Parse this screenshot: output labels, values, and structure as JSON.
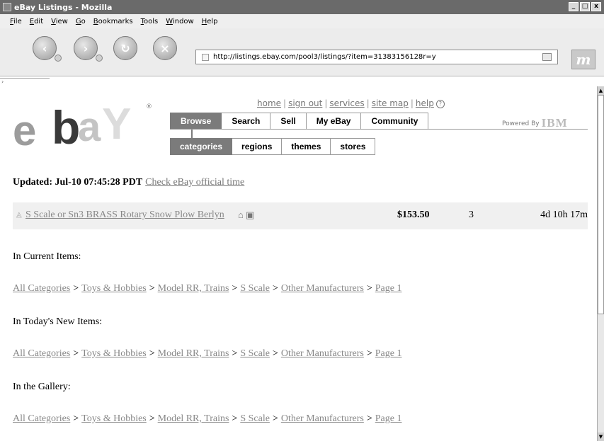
{
  "window": {
    "title": "eBay Listings - Mozilla",
    "controls": [
      "_",
      "□",
      "x"
    ]
  },
  "menu": [
    "File",
    "Edit",
    "View",
    "Go",
    "Bookmarks",
    "Tools",
    "Window",
    "Help"
  ],
  "toolbar": {
    "back_icon": "back-arrow",
    "forward_icon": "forward-arrow",
    "reload_icon": "reload",
    "stop_icon": "stop",
    "url": "http://listings.ebay.com/pool3/listings/?item=31383156128r=y",
    "throbber_label": "m"
  },
  "header": {
    "logo_letters": [
      "e",
      "b",
      "a",
      "Y"
    ],
    "logo_reg": "®",
    "links": [
      "home",
      "sign out",
      "services",
      "site map",
      "help"
    ],
    "help_icon": "?",
    "tabs": [
      "Browse",
      "Search",
      "Sell",
      "My eBay",
      "Community"
    ],
    "powered_by": "Powered By",
    "powered_brand": "IBM",
    "subtabs": [
      "categories",
      "regions",
      "themes",
      "stores"
    ]
  },
  "updated": {
    "label": "Updated: Jul-10 07:45:28 PDT",
    "link": "Check eBay official time"
  },
  "item": {
    "title": "S Scale or Sn3 BRASS Rotary Snow Plow Berlyn",
    "icons": "⌂ ▣",
    "price": "$153.50",
    "bids": "3",
    "time_left": "4d 10h 17m"
  },
  "sections": [
    {
      "label": "In Current Items:",
      "crumbs": [
        "All Categories",
        "Toys & Hobbies",
        "Model RR, Trains",
        "S Scale",
        "Other Manufacturers",
        "Page 1"
      ]
    },
    {
      "label": "In Today's New Items:",
      "crumbs": [
        "All Categories",
        "Toys & Hobbies",
        "Model RR, Trains",
        "S Scale",
        "Other Manufacturers",
        "Page 1"
      ]
    },
    {
      "label": "In the Gallery:",
      "crumbs": [
        "All Categories",
        "Toys & Hobbies",
        "Model RR, Trains",
        "S Scale",
        "Other Manufacturers",
        "Page 1"
      ]
    }
  ]
}
